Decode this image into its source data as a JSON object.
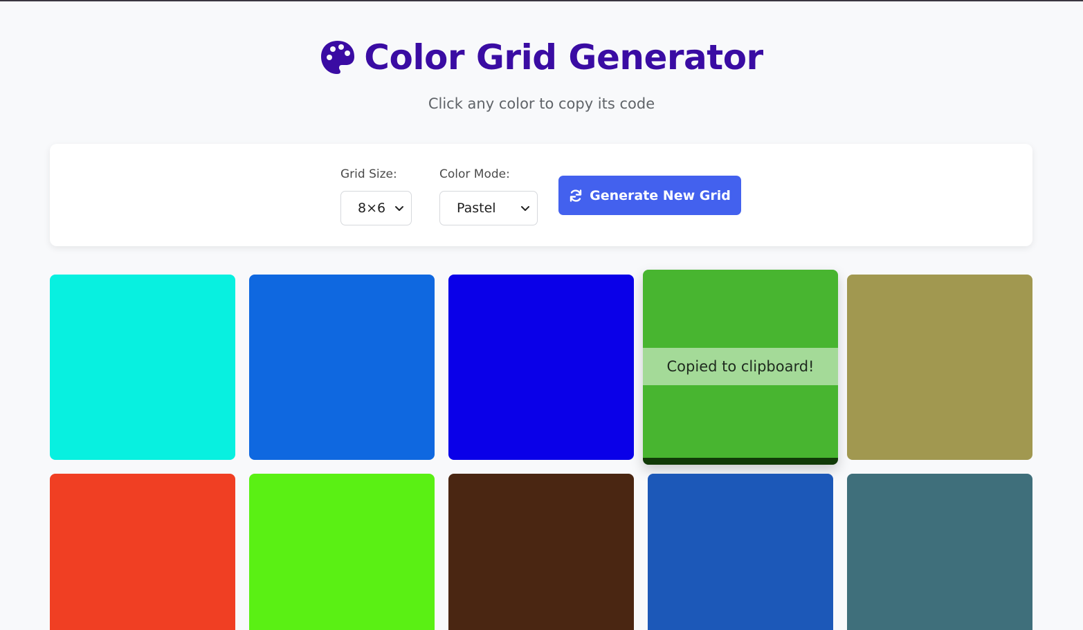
{
  "header": {
    "icon": "palette-icon",
    "title": "Color Grid Generator",
    "subtitle": "Click any color to copy its code",
    "title_color": "#3a0ca3"
  },
  "controls": {
    "grid_size": {
      "label": "Grid Size:",
      "value": "8×6"
    },
    "color_mode": {
      "label": "Color Mode:",
      "value": "Pastel"
    },
    "generate_button": {
      "label": "Generate New Grid",
      "icon": "refresh-icon",
      "color": "#4361ee"
    }
  },
  "grid": {
    "toast": "Copied to clipboard!",
    "swatches": [
      {
        "color": "#08f0e0"
      },
      {
        "color": "#0f68e0"
      },
      {
        "color": "#0a00e8"
      },
      {
        "color": "#48b530",
        "active": true
      },
      {
        "color": "#a19850"
      },
      {
        "color": "#f03f23"
      },
      {
        "color": "#5af014"
      },
      {
        "color": "#4a2612"
      },
      {
        "color": "#1c58b8"
      },
      {
        "color": "#3f6f7b"
      }
    ]
  }
}
